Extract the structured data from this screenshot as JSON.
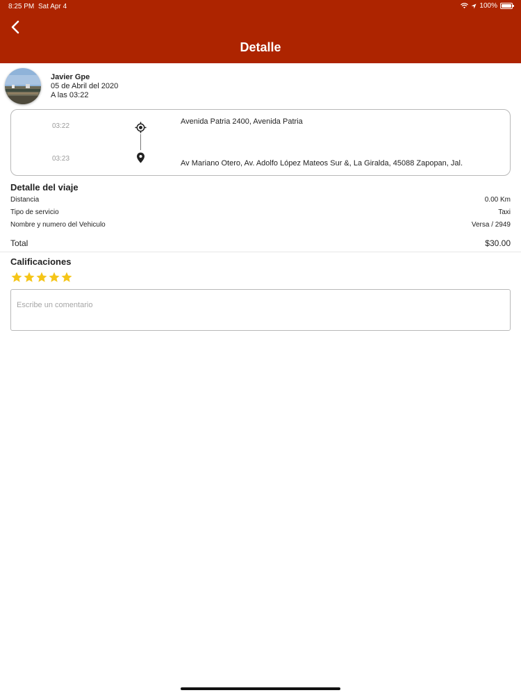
{
  "status_bar": {
    "time": "8:25 PM",
    "date": "Sat Apr 4",
    "battery": "100%",
    "icons": [
      "wifi-icon",
      "location-arrow-icon",
      "battery-icon"
    ]
  },
  "header": {
    "title": "Detalle",
    "back_icon": "chevron-left-icon",
    "color": "#ad2400"
  },
  "user": {
    "name": "Javier Gpe",
    "date": "05 de Abril del 2020",
    "time": "A las 03:22"
  },
  "route": {
    "origin": {
      "time": "03:22",
      "address": "Avenida Patria 2400, Avenida Patria",
      "icon": "crosshair-icon"
    },
    "destination": {
      "time": "03:23",
      "address": "Av Mariano Otero, Av. Adolfo López Mateos Sur &, La Giralda, 45088 Zapopan, Jal.",
      "icon": "map-pin-icon"
    }
  },
  "trip_detail": {
    "title": "Detalle del viaje",
    "rows": [
      {
        "label": "Distancia",
        "value": "0.00 Km"
      },
      {
        "label": "Tipo de servicio",
        "value": "Taxi"
      },
      {
        "label": "Nombre y numero del Vehiculo",
        "value": "Versa / 2949"
      }
    ],
    "total_label": "Total",
    "total_value": "$30.00"
  },
  "rating": {
    "title": "Calificaciones",
    "stars": 5,
    "max_stars": 5,
    "star_color": "#f5c518"
  },
  "comment": {
    "placeholder": "Escribe un comentario",
    "value": ""
  }
}
